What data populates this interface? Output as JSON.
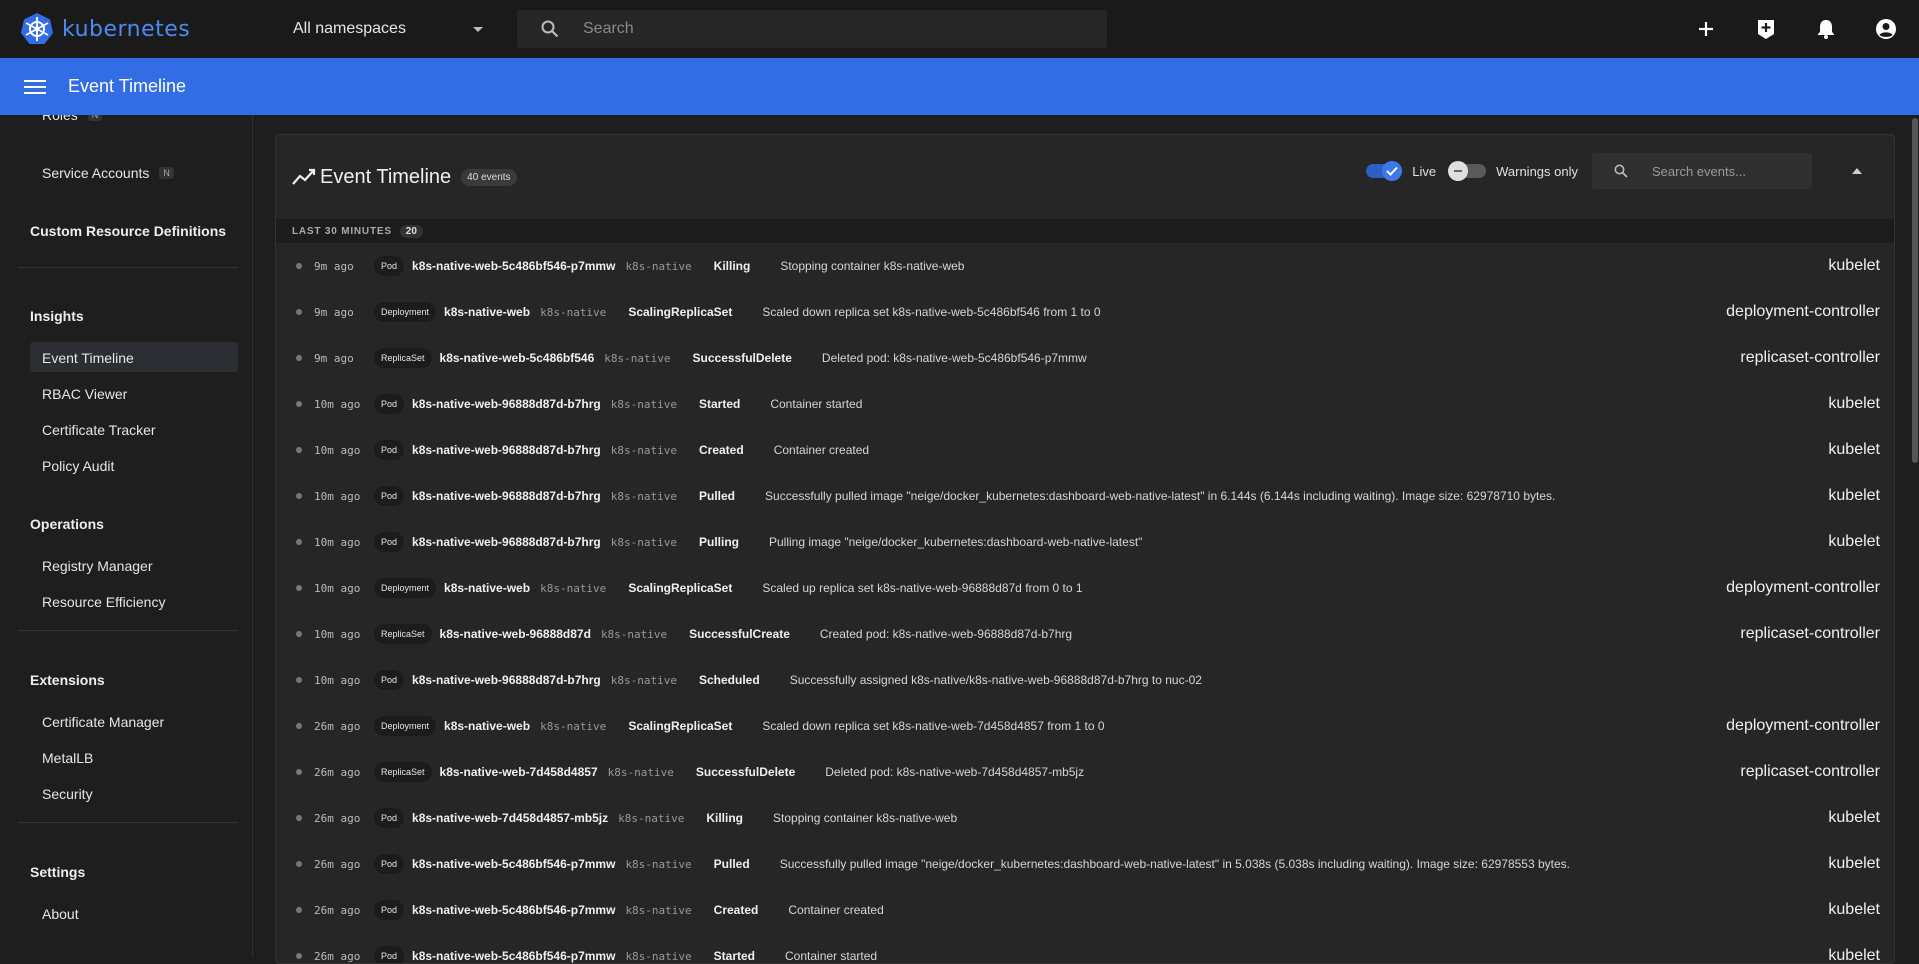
{
  "brand": {
    "name": "kubernetes"
  },
  "namespace": {
    "selected": "All namespaces"
  },
  "search": {
    "placeholder": "Search"
  },
  "app_bar": {
    "title": "Event Timeline"
  },
  "sidebar": {
    "items_top": [
      {
        "label": "Roles",
        "badge": "N"
      },
      {
        "label": "Service Accounts",
        "badge": "N"
      }
    ],
    "crd": "Custom Resource Definitions",
    "insights": {
      "heading": "Insights",
      "items": [
        "Event Timeline",
        "RBAC Viewer",
        "Certificate Tracker",
        "Policy Audit"
      ]
    },
    "operations": {
      "heading": "Operations",
      "items": [
        "Registry Manager",
        "Resource Efficiency"
      ]
    },
    "extensions": {
      "heading": "Extensions",
      "items": [
        "Certificate Manager",
        "MetalLB",
        "Security"
      ]
    },
    "settings": {
      "heading": "Settings",
      "items": [
        "About"
      ]
    }
  },
  "panel": {
    "title": "Event Timeline",
    "count": "40 events",
    "live_label": "Live",
    "live_on": true,
    "warnings_label": "Warnings only",
    "warnings_on": false,
    "search_placeholder": "Search events..."
  },
  "section": {
    "label": "LAST 30 MINUTES",
    "count": "20"
  },
  "events": [
    {
      "age": "9m ago",
      "kind": "Pod",
      "name": "k8s-native-web-5c486bf546-p7mmw",
      "ns": "k8s-native",
      "reason": "Killing",
      "message": "Stopping container k8s-native-web",
      "source": "kubelet"
    },
    {
      "age": "9m ago",
      "kind": "Deployment",
      "name": "k8s-native-web",
      "ns": "k8s-native",
      "reason": "ScalingReplicaSet",
      "message": "Scaled down replica set k8s-native-web-5c486bf546 from 1 to 0",
      "source": "deployment-controller"
    },
    {
      "age": "9m ago",
      "kind": "ReplicaSet",
      "name": "k8s-native-web-5c486bf546",
      "ns": "k8s-native",
      "reason": "SuccessfulDelete",
      "message": "Deleted pod: k8s-native-web-5c486bf546-p7mmw",
      "source": "replicaset-controller"
    },
    {
      "age": "10m ago",
      "kind": "Pod",
      "name": "k8s-native-web-96888d87d-b7hrg",
      "ns": "k8s-native",
      "reason": "Started",
      "message": "Container started",
      "source": "kubelet"
    },
    {
      "age": "10m ago",
      "kind": "Pod",
      "name": "k8s-native-web-96888d87d-b7hrg",
      "ns": "k8s-native",
      "reason": "Created",
      "message": "Container created",
      "source": "kubelet"
    },
    {
      "age": "10m ago",
      "kind": "Pod",
      "name": "k8s-native-web-96888d87d-b7hrg",
      "ns": "k8s-native",
      "reason": "Pulled",
      "message": "Successfully pulled image \"neige/docker_kubernetes:dashboard-web-native-latest\" in 6.144s (6.144s including waiting). Image size: 62978710 bytes.",
      "source": "kubelet"
    },
    {
      "age": "10m ago",
      "kind": "Pod",
      "name": "k8s-native-web-96888d87d-b7hrg",
      "ns": "k8s-native",
      "reason": "Pulling",
      "message": "Pulling image \"neige/docker_kubernetes:dashboard-web-native-latest\"",
      "source": "kubelet"
    },
    {
      "age": "10m ago",
      "kind": "Deployment",
      "name": "k8s-native-web",
      "ns": "k8s-native",
      "reason": "ScalingReplicaSet",
      "message": "Scaled up replica set k8s-native-web-96888d87d from 0 to 1",
      "source": "deployment-controller"
    },
    {
      "age": "10m ago",
      "kind": "ReplicaSet",
      "name": "k8s-native-web-96888d87d",
      "ns": "k8s-native",
      "reason": "SuccessfulCreate",
      "message": "Created pod: k8s-native-web-96888d87d-b7hrg",
      "source": "replicaset-controller"
    },
    {
      "age": "10m ago",
      "kind": "Pod",
      "name": "k8s-native-web-96888d87d-b7hrg",
      "ns": "k8s-native",
      "reason": "Scheduled",
      "message": "Successfully assigned k8s-native/k8s-native-web-96888d87d-b7hrg to nuc-02",
      "source": ""
    },
    {
      "age": "26m ago",
      "kind": "Deployment",
      "name": "k8s-native-web",
      "ns": "k8s-native",
      "reason": "ScalingReplicaSet",
      "message": "Scaled down replica set k8s-native-web-7d458d4857 from 1 to 0",
      "source": "deployment-controller"
    },
    {
      "age": "26m ago",
      "kind": "ReplicaSet",
      "name": "k8s-native-web-7d458d4857",
      "ns": "k8s-native",
      "reason": "SuccessfulDelete",
      "message": "Deleted pod: k8s-native-web-7d458d4857-mb5jz",
      "source": "replicaset-controller"
    },
    {
      "age": "26m ago",
      "kind": "Pod",
      "name": "k8s-native-web-7d458d4857-mb5jz",
      "ns": "k8s-native",
      "reason": "Killing",
      "message": "Stopping container k8s-native-web",
      "source": "kubelet"
    },
    {
      "age": "26m ago",
      "kind": "Pod",
      "name": "k8s-native-web-5c486bf546-p7mmw",
      "ns": "k8s-native",
      "reason": "Pulled",
      "message": "Successfully pulled image \"neige/docker_kubernetes:dashboard-web-native-latest\" in 5.038s (5.038s including waiting). Image size: 62978553 bytes.",
      "source": "kubelet"
    },
    {
      "age": "26m ago",
      "kind": "Pod",
      "name": "k8s-native-web-5c486bf546-p7mmw",
      "ns": "k8s-native",
      "reason": "Created",
      "message": "Container created",
      "source": "kubelet"
    },
    {
      "age": "26m ago",
      "kind": "Pod",
      "name": "k8s-native-web-5c486bf546-p7mmw",
      "ns": "k8s-native",
      "reason": "Started",
      "message": "Container started",
      "source": "kubelet"
    }
  ],
  "colors": {
    "accent": "#326de6",
    "topbar": "#1a1a1a",
    "background": "#1e1e1e"
  }
}
